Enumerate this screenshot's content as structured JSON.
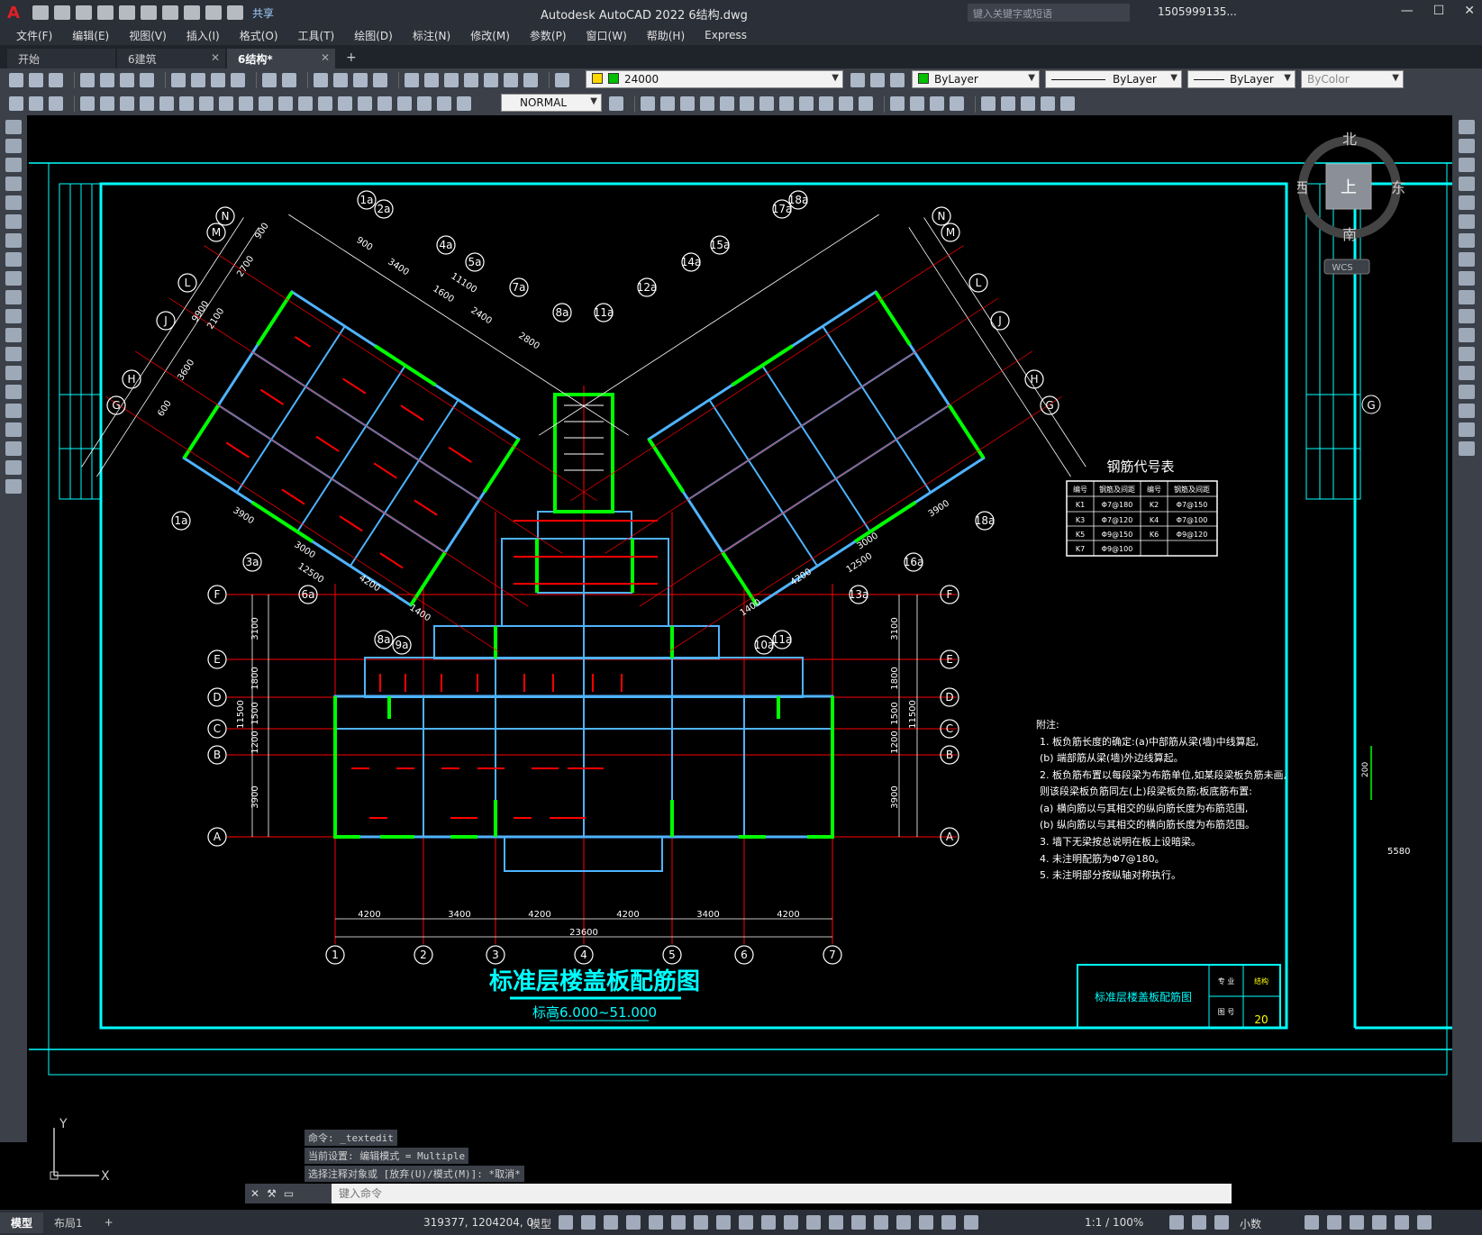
{
  "titlebar": {
    "app_logo": "A",
    "share": "共享",
    "title": "Autodesk AutoCAD 2022    6结构.dwg",
    "search_placeholder": "键入关键字或短语",
    "user": "1505999135...",
    "buttons": [
      "—",
      "☐",
      "✕"
    ]
  },
  "menubar": {
    "items": [
      "文件(F)",
      "编辑(E)",
      "视图(V)",
      "插入(I)",
      "格式(O)",
      "工具(T)",
      "绘图(D)",
      "标注(N)",
      "修改(M)",
      "参数(P)",
      "窗口(W)",
      "帮助(H)",
      "Express"
    ]
  },
  "tabs": {
    "items": [
      "开始",
      "6建筑",
      "6结构*"
    ],
    "close": "✕",
    "plus": "+"
  },
  "toolbar": {
    "layer_value": "24000",
    "color_value": "ByLayer",
    "linetype_value": "ByLayer",
    "lineweight_value": "ByLayer",
    "plotstyle_value": "ByColor",
    "dimstyle_value": "NORMAL"
  },
  "viewcube": {
    "north": "北",
    "south": "南",
    "east": "东",
    "west": "西",
    "top": "上",
    "wcs": "WCS"
  },
  "drawing": {
    "title": "标准层楼盖板配筋图",
    "subtitle": "标高6.000~51.000",
    "rebar_table_title": "钢筋代号表",
    "rebar_table_headers": [
      "编号",
      "钢筋及间距",
      "编号",
      "钢筋及间距"
    ],
    "rebar_table_rows": [
      [
        "K1",
        "Φ7@180",
        "K2",
        "Φ7@150"
      ],
      [
        "K3",
        "Φ7@120",
        "K4",
        "Φ7@100"
      ],
      [
        "K5",
        "Φ9@150",
        "K6",
        "Φ9@120"
      ],
      [
        "K7",
        "Φ9@100",
        "",
        ""
      ]
    ],
    "notes_title": "附注:",
    "notes": [
      "1. 板负筋长度的确定:(a)中部筋从梁(墙)中线算起,",
      "   (b) 端部筋从梁(墙)外边线算起。",
      "2. 板负筋布置以每段梁为布筋单位,如某段梁板负筋未画,",
      "   则该段梁板负筋同左(上)段梁板负筋;板底筋布置:",
      "   (a) 横向筋以与其相交的纵向筋长度为布筋范围,",
      "   (b) 纵向筋以与其相交的横向筋长度为布筋范围。",
      "3. 墙下无梁按总说明在板上设暗梁。",
      "4. 未注明配筋为Φ7@180。",
      "5. 未注明部分按纵轴对称执行。"
    ],
    "title_block": {
      "name": "标准层楼盖板配筋图",
      "label_major": "专 业",
      "major": "结构",
      "label_sheet": "图 号",
      "sheet_no": "20"
    },
    "grid_rows": [
      "F",
      "E",
      "D",
      "C",
      "B",
      "A"
    ],
    "grid_cols": [
      "1",
      "2",
      "3",
      "4",
      "5",
      "6",
      "7"
    ],
    "row_dims": [
      "3100",
      "1800",
      "1500",
      "1200",
      "3900"
    ],
    "row_total": "11500",
    "col_dims": [
      "4200",
      "3400",
      "4200",
      "4200",
      "3400",
      "4200"
    ],
    "col_total": "23600",
    "left_wing_axes": [
      "N",
      "M",
      "L",
      "J",
      "H",
      "G"
    ],
    "right_wing_axes": [
      "N",
      "M",
      "L",
      "J",
      "H",
      "G"
    ],
    "left_wing_top": [
      "1a",
      "2a",
      "4a",
      "5a",
      "7a",
      "8a"
    ],
    "right_wing_top": [
      "18a",
      "17a",
      "15a",
      "14a",
      "12a",
      "11a"
    ],
    "left_wing_bottom": [
      "1a",
      "3a",
      "6a",
      "8a",
      "9a"
    ],
    "right_wing_bottom": [
      "18a",
      "16a",
      "13a",
      "11a",
      "10a"
    ],
    "left_wing_dims_top": [
      "900",
      "3400",
      "11100",
      "1600",
      "2400",
      "2800"
    ],
    "left_wing_dims_side": [
      "900",
      "2700",
      "9900",
      "2100",
      "3600",
      "600"
    ],
    "left_wing_dims_bottom": [
      "3900",
      "3000",
      "12500",
      "4200",
      "1400"
    ],
    "right_wing_dims_bottom": [
      "3900",
      "3000",
      "12500",
      "4200",
      "1400"
    ],
    "partial_right_dim": "5580",
    "partial_right_value": "200",
    "partial_right_axis": "G"
  },
  "command": {
    "history": [
      "命令: _textedit",
      "当前设置: 编辑模式 = Multiple",
      "选择注释对象或 [放弃(U)/模式(M)]: *取消*"
    ],
    "placeholder": "键入命令"
  },
  "ucs": {
    "x": "X",
    "y": "Y"
  },
  "statusbar": {
    "tabs": [
      "模型",
      "布局1",
      "+"
    ],
    "coords": "319377, 1204204, 0",
    "model": "模型",
    "scale": "1:1 / 100%",
    "units": "小数"
  },
  "colors": {
    "accent_cyan": "#00ffff",
    "wall_green": "#00ff00",
    "rebar_red": "#ff0000",
    "grid_white": "#ffffff",
    "beam_blue": "#4fb3ff",
    "yellow": "#ffff00"
  }
}
